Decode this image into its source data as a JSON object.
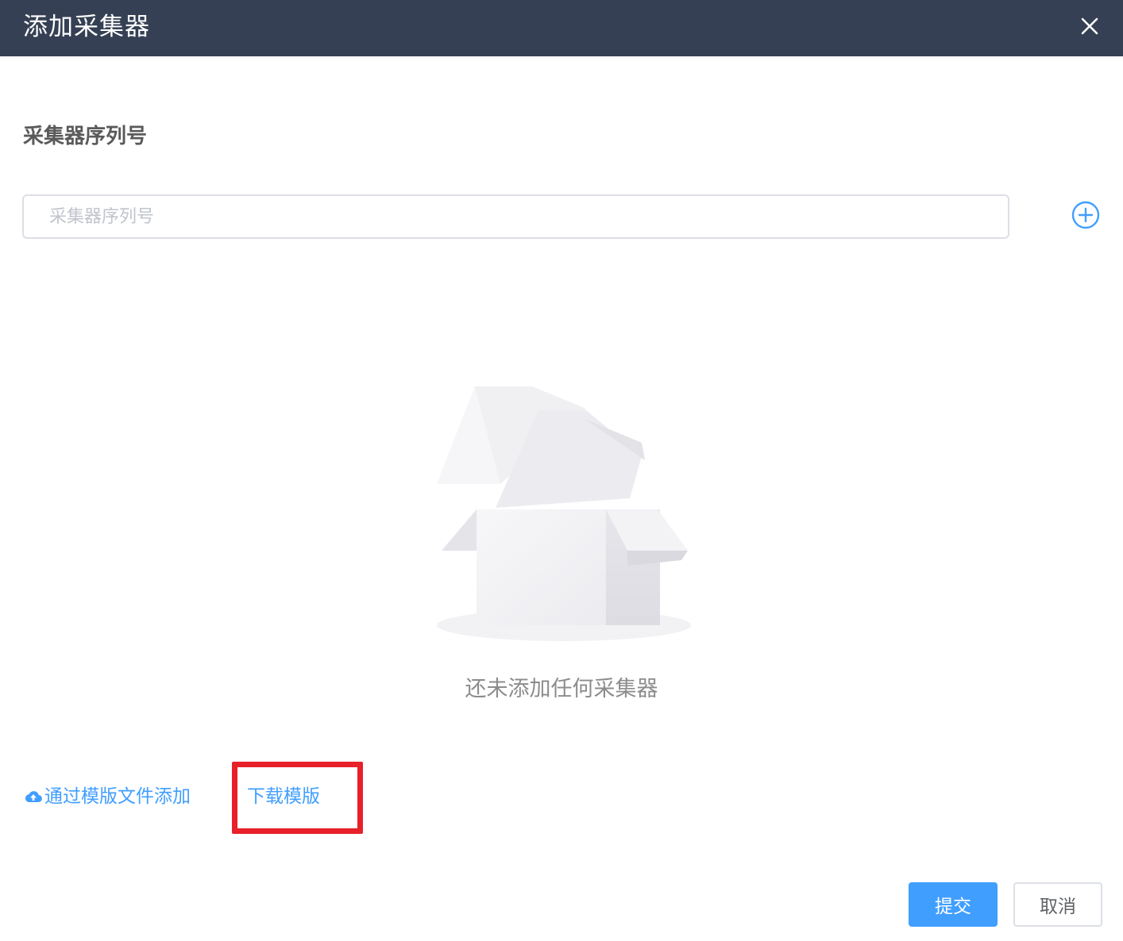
{
  "dialog": {
    "title": "添加采集器",
    "close_icon": "close-icon"
  },
  "form": {
    "label": "采集器序列号",
    "serial_input": {
      "placeholder": "采集器序列号",
      "value": ""
    },
    "add_icon": "plus-circle-icon"
  },
  "empty_state": {
    "illustration": "empty-box-icon",
    "text": "还未添加任何采集器"
  },
  "actions": {
    "upload_icon": "cloud-upload-icon",
    "upload_label": "通过模版文件添加",
    "download_label": "下载模版",
    "submit_label": "提交",
    "cancel_label": "取消"
  },
  "colors": {
    "header_bg": "#354054",
    "primary": "#409eff",
    "highlight": "#e8202a"
  }
}
